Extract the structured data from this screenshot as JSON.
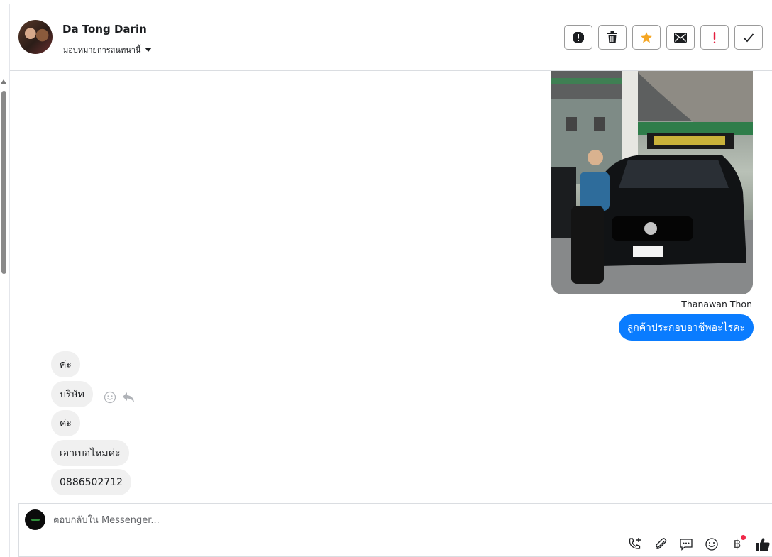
{
  "header": {
    "contact_name": "Da Tong Darin",
    "assign_label": "มอบหมายการสนทนานี้",
    "actions": [
      {
        "name": "report-button",
        "icon": "alert-octagon-icon"
      },
      {
        "name": "delete-button",
        "icon": "trash-icon"
      },
      {
        "name": "star-button",
        "icon": "star-icon",
        "color": "#f5a623"
      },
      {
        "name": "mark-unread-button",
        "icon": "envelope-icon"
      },
      {
        "name": "follow-up-button",
        "icon": "exclamation-icon",
        "color": "#e41e3f"
      },
      {
        "name": "done-button",
        "icon": "check-icon"
      }
    ]
  },
  "messages": {
    "outgoing_sender": "Thanawan Thon",
    "outgoing_text": "ลูกค้าประกอบอาชีพอะไรคะ",
    "incoming": [
      "ค่ะ",
      "บริษัท",
      "ค่ะ",
      "เอาเบอไหมค่ะ",
      "0886502712"
    ]
  },
  "composer": {
    "placeholder": "ตอบกลับใน Messenger...",
    "tool_icons": [
      "phone-add-icon",
      "paperclip-icon",
      "saved-reply-icon",
      "emoji-icon",
      "baht-icon",
      "like-icon"
    ],
    "baht_symbol": "฿"
  },
  "colors": {
    "outgoing_bubble": "#0a7cff",
    "incoming_bubble": "#f0f0f0",
    "notification_dot": "#f02849"
  }
}
